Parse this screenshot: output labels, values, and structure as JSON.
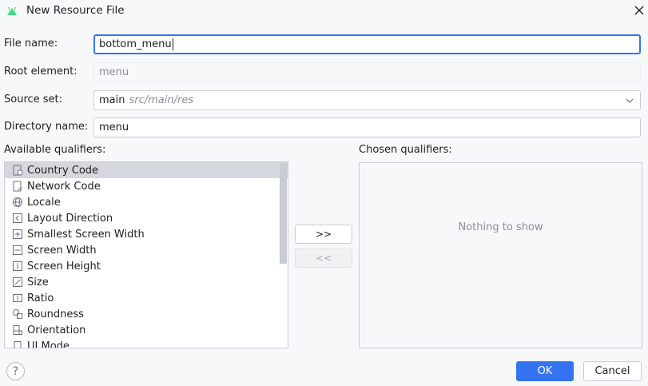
{
  "window": {
    "title": "New Resource File",
    "close_icon": "close-icon",
    "app_icon": "android-icon"
  },
  "form": {
    "file_name": {
      "label": "File name:",
      "value": "bottom_menu"
    },
    "root_element": {
      "label": "Root element:",
      "placeholder": "menu"
    },
    "source_set": {
      "label": "Source set:",
      "value": "main",
      "hint": "src/main/res"
    },
    "directory_name": {
      "label": "Directory name:",
      "value": "menu"
    }
  },
  "qualifiers": {
    "available_label": "Available qualifiers:",
    "chosen_label": "Chosen qualifiers:",
    "items": [
      {
        "label": "Country Code",
        "icon": "country-code-icon",
        "selected": true
      },
      {
        "label": "Network Code",
        "icon": "network-code-icon",
        "selected": false
      },
      {
        "label": "Locale",
        "icon": "globe-icon",
        "selected": false
      },
      {
        "label": "Layout Direction",
        "icon": "layout-direction-icon",
        "selected": false
      },
      {
        "label": "Smallest Screen Width",
        "icon": "smallest-width-icon",
        "selected": false
      },
      {
        "label": "Screen Width",
        "icon": "screen-width-icon",
        "selected": false
      },
      {
        "label": "Screen Height",
        "icon": "screen-height-icon",
        "selected": false
      },
      {
        "label": "Size",
        "icon": "size-icon",
        "selected": false
      },
      {
        "label": "Ratio",
        "icon": "ratio-icon",
        "selected": false
      },
      {
        "label": "Roundness",
        "icon": "roundness-icon",
        "selected": false
      },
      {
        "label": "Orientation",
        "icon": "orientation-icon",
        "selected": false
      },
      {
        "label": "UI Mode",
        "icon": "ui-mode-icon",
        "selected": false
      }
    ],
    "add_button": ">>",
    "remove_button": "<<",
    "empty_text": "Nothing to show"
  },
  "footer": {
    "help": "?",
    "ok": "OK",
    "cancel": "Cancel"
  },
  "colors": {
    "accent": "#3574f0",
    "selection": "#d5d7de",
    "background": "#f7f8fa"
  }
}
